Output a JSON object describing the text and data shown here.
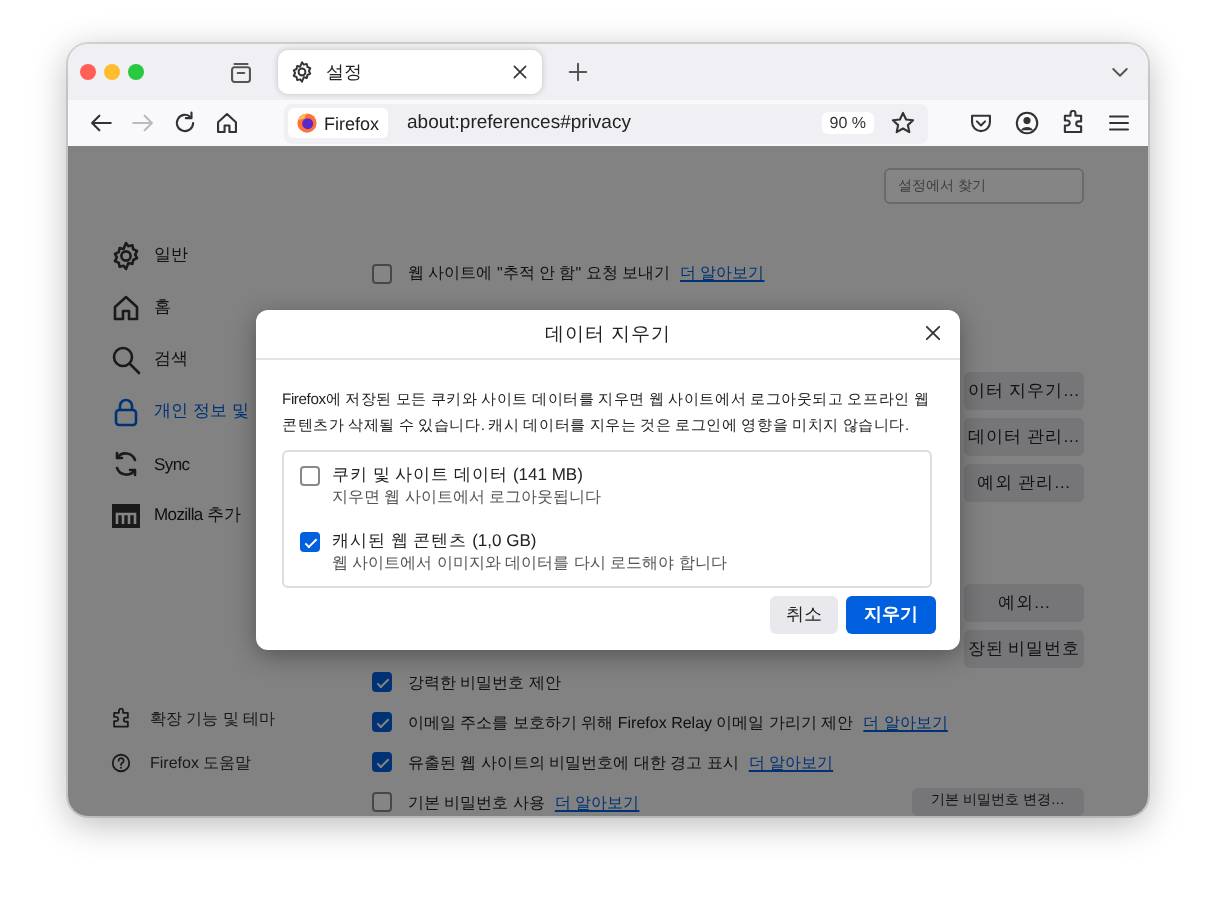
{
  "browser": {
    "tab": {
      "title": "설정",
      "selected": true
    },
    "forward_disabled": true,
    "url_badge": "Firefox",
    "url": "about:preferences#privacy",
    "zoom": "90 %"
  },
  "search": {
    "placeholder": "설정에서 찾기"
  },
  "sidebar": {
    "items": [
      {
        "label": "일반",
        "selected": false
      },
      {
        "label": "홈",
        "selected": false
      },
      {
        "label": "검색",
        "selected": false
      },
      {
        "label": "개인 정보 및",
        "selected": true
      },
      {
        "label": "Sync",
        "selected": false
      },
      {
        "label": "Mozilla 추가",
        "selected": false
      }
    ],
    "footer": [
      {
        "label": "확장 기능 및 테마"
      },
      {
        "label": "Firefox 도움말"
      }
    ]
  },
  "content": {
    "top_rows": [
      {
        "label": "웹 사이트에 \"추적 안 함\" 요청 보내기",
        "checked": false,
        "link": "더 알아보기"
      }
    ],
    "upper_buttons": [
      "이터 지우기…",
      "데이터 관리…",
      "예외 관리…"
    ],
    "lower_buttons": [
      "예외…",
      "장된 비밀번호"
    ],
    "bottom_rows": [
      {
        "label": "강력한 비밀번호 제안",
        "checked": true
      },
      {
        "label": "이메일 주소를 보호하기 위해 Firefox Relay 이메일 가리기 제안",
        "checked": true,
        "link": "더 알아보기"
      },
      {
        "label": "유출된 웹 사이트의 비밀번호에 대한 경고 표시",
        "checked": true,
        "link": "더 알아보기"
      },
      {
        "label": "기본 비밀번호 사용",
        "checked": false,
        "link": "더 알아보기",
        "button": "기본 비밀번호 변경…"
      }
    ]
  },
  "dialog": {
    "title": "데이터 지우기",
    "description": "Firefox에 저장된 모든 쿠키와 사이트 데이터를 지우면 웹 사이트에서 로그아웃되고 오프라인 웹 콘텐츠가 삭제될 수 있습니다. 캐시 데이터를 지우는 것은 로그인에 영향을 미치지 않습니다.",
    "options": [
      {
        "label": "쿠키 및 사이트 데이터 (141 MB)",
        "note": "지우면 웹 사이트에서 로그아웃됩니다",
        "checked": false
      },
      {
        "label": "캐시된 웹 콘텐츠 (1,0 GB)",
        "note": "웹 사이트에서 이미지와 데이터를 다시 로드해야 합니다",
        "checked": true
      }
    ],
    "buttons": [
      {
        "label": "취소",
        "primary": false
      },
      {
        "label": "지우기",
        "primary": true
      }
    ]
  }
}
